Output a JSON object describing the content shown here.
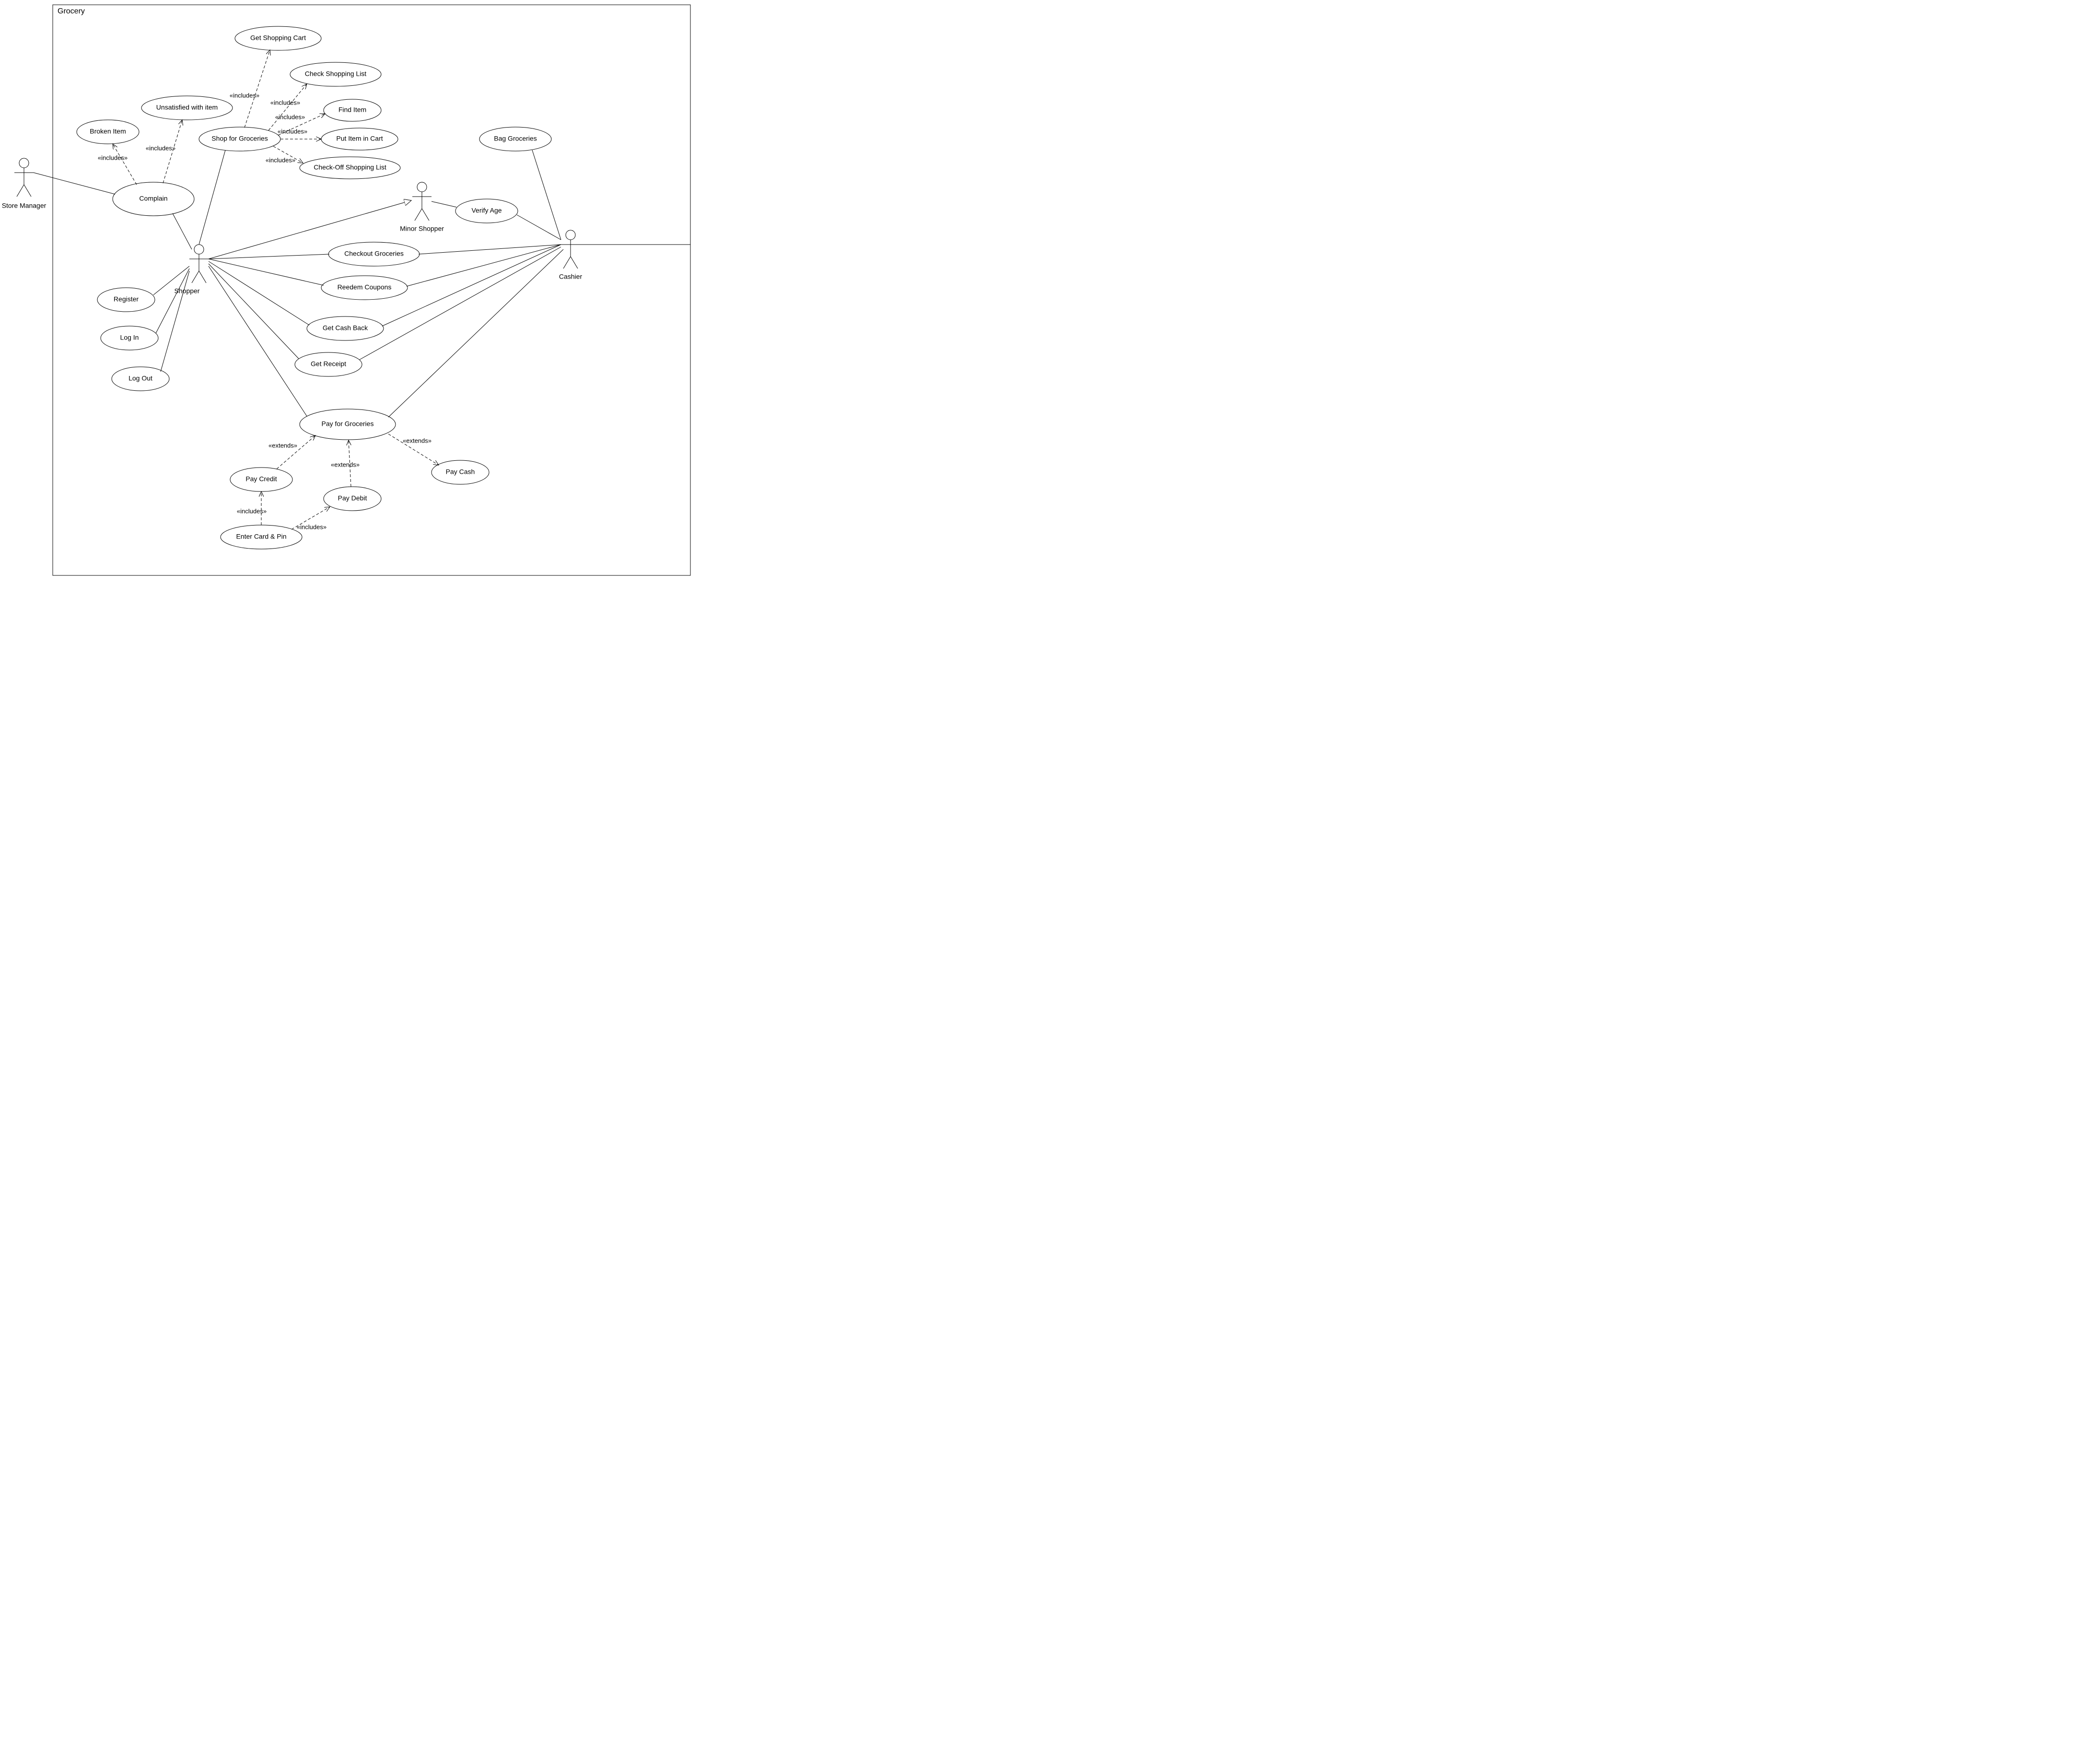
{
  "system": {
    "title": "Grocery"
  },
  "actors": {
    "storeManager": "Store Manager",
    "shopper": "Shopper",
    "minorShopper": "Minor Shopper",
    "cashier": "Cashier"
  },
  "usecases": {
    "brokenItem": "Broken Item",
    "unsatisfied": "Unsatisfied with item",
    "complain": "Complain",
    "register": "Register",
    "login": "Log In",
    "logout": "Log Out",
    "shopForGroceries": "Shop for Groceries",
    "getShoppingCart": "Get Shopping Cart",
    "checkShoppingList": "Check Shopping List",
    "findItem": "Find Item",
    "putItemInCart": "Put Item in Cart",
    "checkOffList": "Check-Off Shopping List",
    "checkoutGroceries": "Checkout Groceries",
    "redeemCoupons": "Reedem Coupons",
    "getCashBack": "Get Cash Back",
    "getReceipt": "Get Receipt",
    "bagGroceries": "Bag Groceries",
    "verifyAge": "Verify Age",
    "payForGroceries": "Pay for Groceries",
    "payCredit": "Pay Credit",
    "payDebit": "Pay Debit",
    "payCash": "Pay Cash",
    "enterCardPin": "Enter Card & Pin"
  },
  "stereotypes": {
    "includes": "«includes»",
    "extends": "«extends»"
  }
}
